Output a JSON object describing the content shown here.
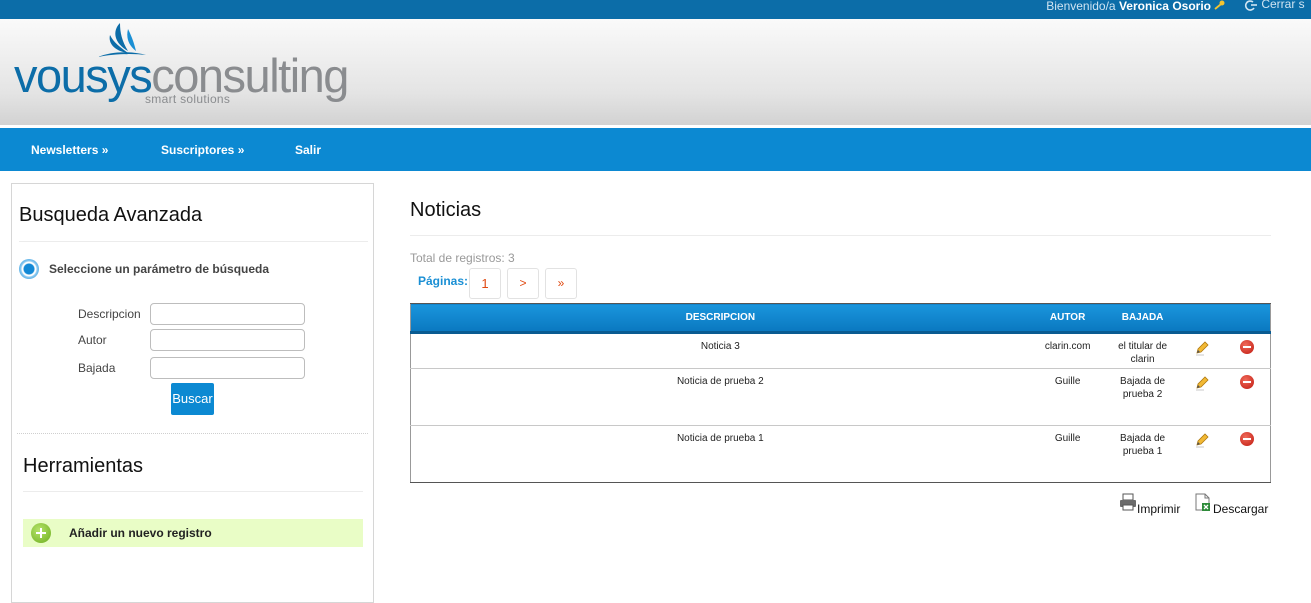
{
  "topbar": {
    "welcome_prefix": "Bienvenido/a",
    "user_name": "Veronica Osorio",
    "logout_label": "Cerrar s"
  },
  "brand": {
    "name_part1": "vousys",
    "name_part2": "consulting",
    "tagline": "smart solutions"
  },
  "nav": {
    "items": [
      {
        "label": "Newsletters »",
        "icon": "none"
      },
      {
        "label": "Suscriptores »",
        "icon": "none"
      },
      {
        "label": "Salir",
        "icon": "none"
      }
    ]
  },
  "sidebar": {
    "search_title": "Busqueda Avanzada",
    "radio_label": "Seleccione un parámetro de búsqueda",
    "fields": [
      {
        "label": "Descripcion",
        "value": ""
      },
      {
        "label": "Autor",
        "value": ""
      },
      {
        "label": "Bajada",
        "value": ""
      }
    ],
    "search_button": "Buscar",
    "tools_title": "Herramientas",
    "add_label": "Añadir un nuevo registro"
  },
  "main": {
    "title": "Noticias",
    "total_label": "Total de registros: 3",
    "pages_label": "Páginas:",
    "pager": [
      "1",
      ">",
      "»"
    ],
    "columns": [
      "DESCRIPCION",
      "AUTOR",
      "BAJADA"
    ],
    "rows": [
      {
        "descripcion": "Noticia 3",
        "autor": "clarin.com",
        "bajada": "el titular de clarin"
      },
      {
        "descripcion": "Noticia de prueba 2",
        "autor": "Guille",
        "bajada": "Bajada de prueba 2"
      },
      {
        "descripcion": "Noticia de prueba 1",
        "autor": "Guille",
        "bajada": "Bajada de prueba 1"
      }
    ],
    "print_label": "Imprimir",
    "download_label": "Descargar"
  },
  "colors": {
    "topbar": "#0c6da8",
    "nav": "#0c89d2",
    "accent_orange": "#e04a12",
    "add_row_bg": "#e9fdc6"
  }
}
